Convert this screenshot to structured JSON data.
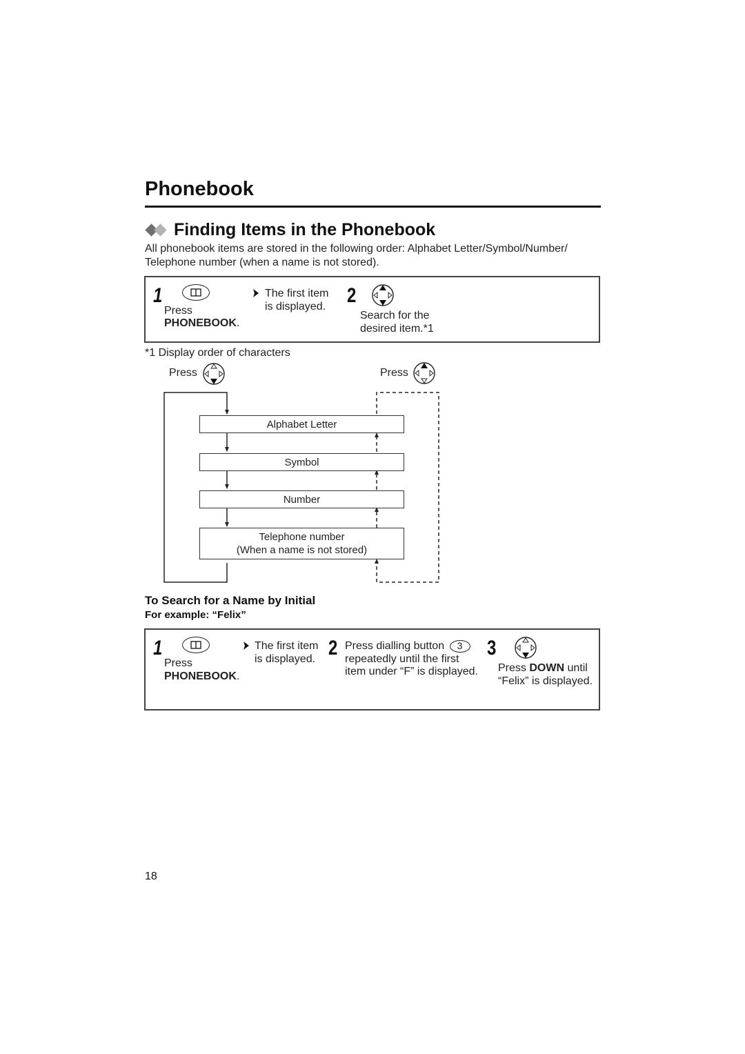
{
  "header": {
    "page_title": "Phonebook",
    "section_title": "Finding Items in the Phonebook",
    "section_icon": "double-diamond-icon",
    "intro": "All phonebook items are stored in the following order: Alphabet Letter/Symbol/Number/ Telephone number (when a name is not stored)."
  },
  "finding_steps": {
    "step1": {
      "number": "1",
      "icon": "phonebook-key-icon",
      "press_label": "Press",
      "key_name": "PHONEBOOK",
      "key_suffix": ".",
      "result_icon": "arrow-right-icon",
      "result_line1": "The first item",
      "result_line2": "is displayed."
    },
    "step2": {
      "number": "2",
      "icon": "navigator-up-down-icon",
      "line1": "Search for the",
      "line2": "desired item.*1"
    }
  },
  "footnote": {
    "text": "*1 Display order of characters",
    "left_press": "Press",
    "left_icon": "navigator-down-icon",
    "right_press": "Press",
    "right_icon": "navigator-up-icon",
    "order": [
      {
        "line1": "Alphabet Letter",
        "line2": ""
      },
      {
        "line1": "Symbol",
        "line2": ""
      },
      {
        "line1": "Number",
        "line2": ""
      },
      {
        "line1": "Telephone number",
        "line2": "(When a name is not stored)"
      }
    ]
  },
  "search_by_initial": {
    "heading": "To Search for a Name by Initial",
    "example": "For example: “Felix”",
    "step1": {
      "number": "1",
      "icon": "phonebook-key-icon",
      "press_label": "Press",
      "key_name": "PHONEBOOK",
      "key_suffix": ".",
      "result_icon": "arrow-right-icon",
      "result_line1": "The first item",
      "result_line2": "is displayed."
    },
    "step2": {
      "number": "2",
      "line1": "Press dialling button",
      "key": "3",
      "line2": "repeatedly until the first",
      "line3": "item under “F” is displayed."
    },
    "step3": {
      "number": "3",
      "icon": "navigator-down-icon",
      "press_label": "Press",
      "key_name": "DOWN",
      "until": "until",
      "line2": "“Felix” is displayed."
    }
  },
  "footer": {
    "page_number": "18"
  }
}
